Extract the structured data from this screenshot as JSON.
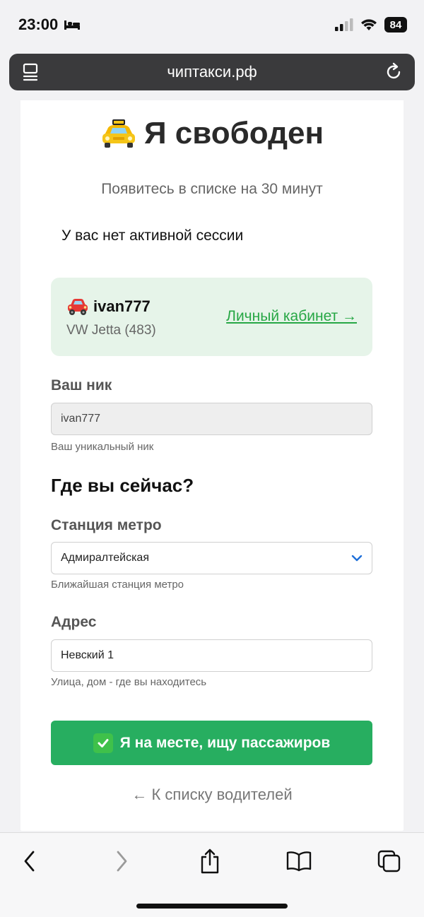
{
  "status_bar": {
    "time": "23:00",
    "battery": "84"
  },
  "browser": {
    "url": "чиптакси.рф"
  },
  "page": {
    "title": "Я свободен",
    "subtitle": "Появитесь в списке на 30 минут",
    "session_status": "У вас нет активной сессии",
    "driver": {
      "name": "ivan777",
      "car": "VW Jetta (483)",
      "cabinet_link": "Личный кабинет →"
    },
    "form": {
      "nick_label": "Ваш ник",
      "nick_value": "ivan777",
      "nick_hint": "Ваш уникальный ник",
      "location_title": "Где вы сейчас?",
      "metro_label": "Станция метро",
      "metro_value": "Адмиралтейская",
      "metro_hint": "Ближайшая станция метро",
      "address_label": "Адрес",
      "address_value": "Невский 1",
      "address_hint": "Улица, дом - где вы находитесь",
      "submit_label": "Я на месте, ищу пассажиров"
    },
    "back_link": "← К списку водителей"
  },
  "colors": {
    "accent_green": "#27ae60",
    "link_green": "#27a745",
    "card_bg": "#e6f4e9"
  },
  "icons": {
    "title": "taxi-icon",
    "driver": "car-icon",
    "submit": "check-mark-icon"
  }
}
